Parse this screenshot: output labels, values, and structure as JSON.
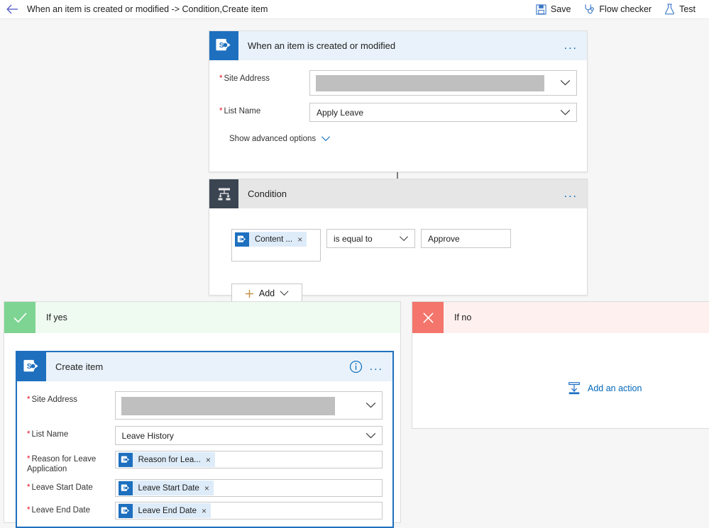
{
  "commandbar": {
    "back_icon": "arrow-left-icon",
    "breadcrumb": "When an item is created or modified -> Condition,Create item",
    "actions": [
      {
        "label": "Save",
        "icon": "save-icon"
      },
      {
        "label": "Flow checker",
        "icon": "stethoscope-icon"
      },
      {
        "label": "Test",
        "icon": "flask-icon"
      }
    ]
  },
  "trigger_card": {
    "title": "When an item is created or modified",
    "icon": "sharepoint-icon",
    "menu": "...",
    "fields": [
      {
        "label": "Site Address",
        "required": true,
        "value": "",
        "redacted": true,
        "type": "dropdown"
      },
      {
        "label": "List Name",
        "required": true,
        "value": "Apply Leave",
        "redacted": false,
        "type": "dropdown"
      }
    ],
    "advanced_link": "Show advanced options",
    "advanced_icon": "chevron-down-icon"
  },
  "condition_card": {
    "title": "Condition",
    "icon": "condition-icon",
    "menu": "...",
    "row": {
      "token": {
        "label": "Content ...",
        "icon": "sharepoint-icon",
        "remove": "×"
      },
      "operator": "is equal to",
      "operator_icon": "chevron-down-icon",
      "value": "Approve"
    },
    "add_button": {
      "label": "Add",
      "plus_icon": "plus-icon",
      "chevron_icon": "chevron-down-icon"
    }
  },
  "branch_yes": {
    "label": "If yes",
    "badge_icon": "check-icon",
    "badge_color": "#7ed492",
    "bg_color": "#effaf1"
  },
  "branch_no": {
    "label": "If no",
    "badge_icon": "close-icon",
    "badge_color": "#f4756b",
    "bg_color": "#fdf0ef",
    "add_action": {
      "label": "Add an action",
      "icon": "add-action-icon"
    }
  },
  "create_item_card": {
    "title": "Create item",
    "icon": "sharepoint-icon",
    "info_icon": "info-icon",
    "menu": "...",
    "fields": [
      {
        "label": "Site Address",
        "required": true,
        "value": "",
        "redacted": true,
        "type": "dropdown"
      },
      {
        "label": "List Name",
        "required": true,
        "value": "Leave History",
        "redacted": false,
        "type": "dropdown"
      },
      {
        "label": "Reason for Leave Application",
        "required": true,
        "type": "token",
        "token": {
          "label": "Reason for Lea...",
          "icon": "sharepoint-icon",
          "remove": "×"
        }
      },
      {
        "label": "Leave Start Date",
        "required": true,
        "type": "token",
        "token": {
          "label": "Leave Start Date",
          "icon": "sharepoint-icon",
          "remove": "×"
        }
      },
      {
        "label": "Leave End Date",
        "required": true,
        "type": "token",
        "token": {
          "label": "Leave End Date",
          "icon": "sharepoint-icon",
          "remove": "×"
        }
      }
    ]
  },
  "colors": {
    "accent": "#0067b8",
    "sharepoint": "#036c70",
    "required": "#e81123",
    "canvas": "#f6f6f6"
  }
}
